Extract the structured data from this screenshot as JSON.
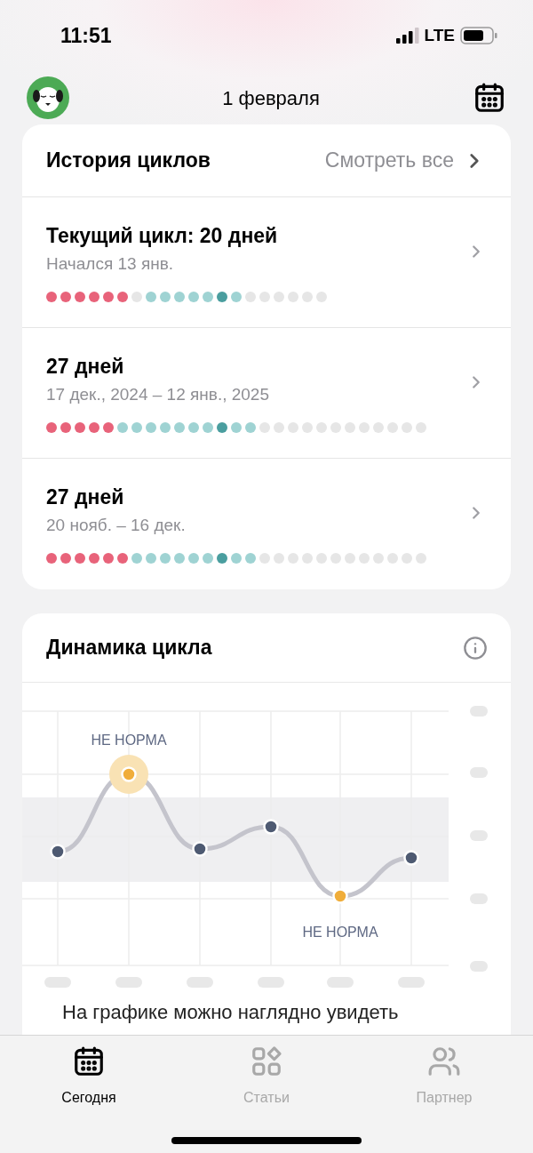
{
  "status_bar": {
    "time": "11:51",
    "network": "LTE"
  },
  "header": {
    "title": "1 февраля"
  },
  "history": {
    "title": "История циклов",
    "link": "Смотреть все",
    "cycles": [
      {
        "title": "Текущий цикл: 20 дней",
        "subtitle": "Начался 13 янв.",
        "dots": [
          {
            "color": "#e8637a"
          },
          {
            "color": "#e8637a"
          },
          {
            "color": "#e8637a"
          },
          {
            "color": "#e8637a"
          },
          {
            "color": "#e8637a"
          },
          {
            "color": "#e8637a"
          },
          {
            "color": "#e6e6e6"
          },
          {
            "color": "#9fd3d3"
          },
          {
            "color": "#9fd3d3"
          },
          {
            "color": "#9fd3d3"
          },
          {
            "color": "#9fd3d3"
          },
          {
            "color": "#9fd3d3"
          },
          {
            "color": "#4a9e9f"
          },
          {
            "color": "#9fd3d3"
          },
          {
            "color": "#e6e6e6"
          },
          {
            "color": "#e6e6e6"
          },
          {
            "color": "#e6e6e6"
          },
          {
            "color": "#e6e6e6"
          },
          {
            "color": "#e6e6e6"
          },
          {
            "color": "#e6e6e6"
          }
        ]
      },
      {
        "title": "27 дней",
        "subtitle": "17 дек., 2024 – 12 янв., 2025",
        "dots": [
          {
            "color": "#e8637a"
          },
          {
            "color": "#e8637a"
          },
          {
            "color": "#e8637a"
          },
          {
            "color": "#e8637a"
          },
          {
            "color": "#e8637a"
          },
          {
            "color": "#9fd3d3"
          },
          {
            "color": "#9fd3d3"
          },
          {
            "color": "#9fd3d3"
          },
          {
            "color": "#9fd3d3"
          },
          {
            "color": "#9fd3d3"
          },
          {
            "color": "#9fd3d3"
          },
          {
            "color": "#9fd3d3"
          },
          {
            "color": "#4a9e9f"
          },
          {
            "color": "#9fd3d3"
          },
          {
            "color": "#9fd3d3"
          },
          {
            "color": "#e6e6e6"
          },
          {
            "color": "#e6e6e6"
          },
          {
            "color": "#e6e6e6"
          },
          {
            "color": "#e6e6e6"
          },
          {
            "color": "#e6e6e6"
          },
          {
            "color": "#e6e6e6"
          },
          {
            "color": "#e6e6e6"
          },
          {
            "color": "#e6e6e6"
          },
          {
            "color": "#e6e6e6"
          },
          {
            "color": "#e6e6e6"
          },
          {
            "color": "#e6e6e6"
          },
          {
            "color": "#e6e6e6"
          }
        ]
      },
      {
        "title": "27 дней",
        "subtitle": "20 нояб. – 16 дек.",
        "dots": [
          {
            "color": "#e8637a"
          },
          {
            "color": "#e8637a"
          },
          {
            "color": "#e8637a"
          },
          {
            "color": "#e8637a"
          },
          {
            "color": "#e8637a"
          },
          {
            "color": "#e8637a"
          },
          {
            "color": "#9fd3d3"
          },
          {
            "color": "#9fd3d3"
          },
          {
            "color": "#9fd3d3"
          },
          {
            "color": "#9fd3d3"
          },
          {
            "color": "#9fd3d3"
          },
          {
            "color": "#9fd3d3"
          },
          {
            "color": "#4a9e9f"
          },
          {
            "color": "#9fd3d3"
          },
          {
            "color": "#9fd3d3"
          },
          {
            "color": "#e6e6e6"
          },
          {
            "color": "#e6e6e6"
          },
          {
            "color": "#e6e6e6"
          },
          {
            "color": "#e6e6e6"
          },
          {
            "color": "#e6e6e6"
          },
          {
            "color": "#e6e6e6"
          },
          {
            "color": "#e6e6e6"
          },
          {
            "color": "#e6e6e6"
          },
          {
            "color": "#e6e6e6"
          },
          {
            "color": "#e6e6e6"
          },
          {
            "color": "#e6e6e6"
          },
          {
            "color": "#e6e6e6"
          }
        ]
      }
    ]
  },
  "dynamics": {
    "title": "Динамика цикла",
    "points": [
      {
        "kind": "normal"
      },
      {
        "kind": "abnormal",
        "label": "НЕ НОРМА"
      },
      {
        "kind": "normal"
      },
      {
        "kind": "normal"
      },
      {
        "kind": "abnormal",
        "label": "НЕ НОРМА"
      },
      {
        "kind": "normal"
      }
    ],
    "description": "На графике можно наглядно увидеть"
  },
  "tabs": [
    {
      "label": "Сегодня",
      "selected": true,
      "kind": "calendar"
    },
    {
      "label": "Статьи",
      "selected": false,
      "kind": "shapes"
    },
    {
      "label": "Партнер",
      "selected": false,
      "kind": "people"
    }
  ]
}
